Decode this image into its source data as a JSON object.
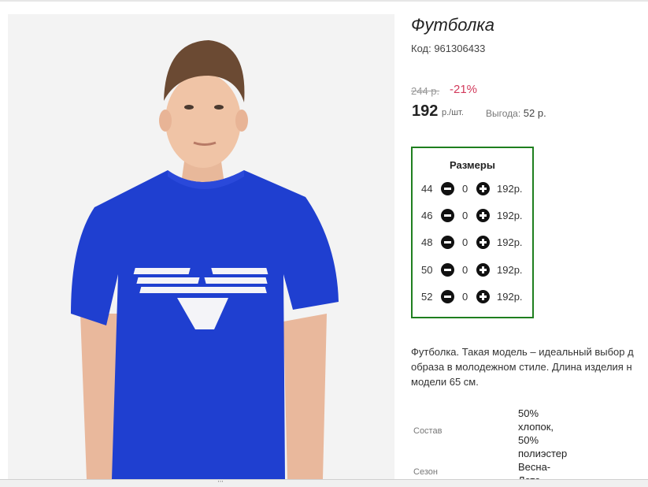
{
  "product": {
    "title": "Футболка",
    "code": "Код: 961306433",
    "old_price": "244 р.",
    "discount": "-21%",
    "price": "192",
    "unit": "р./шт.",
    "saving_label": "Выгода:",
    "saving_value": "52 р."
  },
  "sizes": {
    "title": "Размеры",
    "rows": [
      {
        "size": "44",
        "qty": "0",
        "price": "192р."
      },
      {
        "size": "46",
        "qty": "0",
        "price": "192р."
      },
      {
        "size": "48",
        "qty": "0",
        "price": "192р."
      },
      {
        "size": "50",
        "qty": "0",
        "price": "192р."
      },
      {
        "size": "52",
        "qty": "0",
        "price": "192р."
      }
    ]
  },
  "description": {
    "line1": "Футболка. Такая модель – идеальный выбор д",
    "line2": "образа в молодежном стиле. Длина изделия н",
    "line3": "модели 65 см."
  },
  "specs": [
    {
      "label": "Состав",
      "value": [
        "50%",
        "хлопок,",
        "50%",
        "полиэстер"
      ]
    },
    {
      "label": "Сезон",
      "value": [
        "Весна-",
        "Лето"
      ]
    }
  ],
  "scrollbar": {
    "grip": "'''"
  },
  "colors": {
    "accent_red": "#d23a5b",
    "size_box_border": "#1f7f1f",
    "shirt": "#1f3fd0"
  },
  "image": {
    "shirt_print": "Emporio Armani eagle logo"
  }
}
